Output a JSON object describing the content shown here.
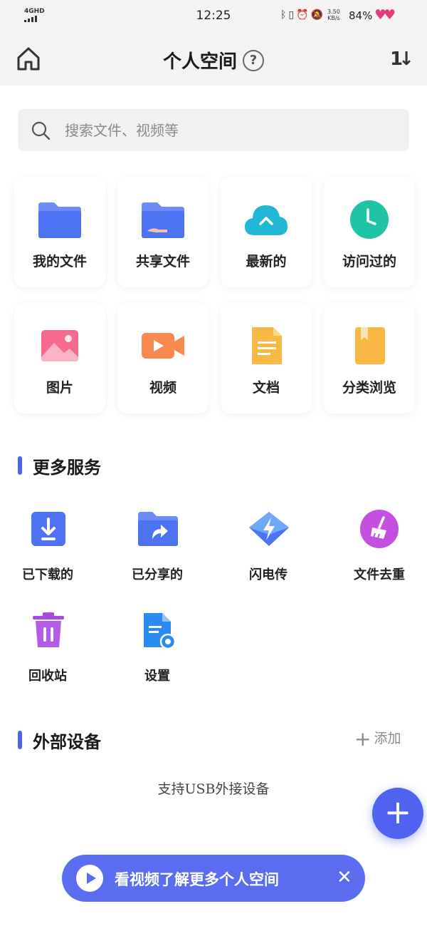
{
  "status_bar": {
    "network": "4GHD",
    "time": "12:25",
    "speed_value": "3.50",
    "speed_unit": "KB/s",
    "battery": "84%"
  },
  "header": {
    "title": "个人空间",
    "help_glyph": "?",
    "sort_glyph": "1↓"
  },
  "search": {
    "placeholder": "搜索文件、视频等"
  },
  "quick_grid": [
    {
      "label": "我的文件",
      "icon": "folder-icon"
    },
    {
      "label": "共享文件",
      "icon": "shared-folder-icon"
    },
    {
      "label": "最新的",
      "icon": "cloud-icon"
    },
    {
      "label": "访问过的",
      "icon": "clock-icon"
    },
    {
      "label": "图片",
      "icon": "image-icon"
    },
    {
      "label": "视频",
      "icon": "video-icon"
    },
    {
      "label": "文档",
      "icon": "document-icon"
    },
    {
      "label": "分类浏览",
      "icon": "bookmark-document-icon"
    }
  ],
  "more_services": {
    "title": "更多服务",
    "items": [
      {
        "label": "已下载的",
        "icon": "download-icon"
      },
      {
        "label": "已分享的",
        "icon": "share-folder-icon"
      },
      {
        "label": "闪电传",
        "icon": "lightning-icon"
      },
      {
        "label": "文件去重",
        "icon": "broom-icon"
      },
      {
        "label": "回收站",
        "icon": "trash-icon"
      },
      {
        "label": "设置",
        "icon": "settings-document-icon"
      }
    ]
  },
  "external_devices": {
    "title": "外部设备",
    "add_label": "添加",
    "hint": "支持USB外接设备"
  },
  "fab": {
    "glyph": "+"
  },
  "banner": {
    "text": "看视频了解更多个人空间",
    "close_glyph": "✕"
  },
  "colors": {
    "accent": "#4f62f0",
    "heart": "#e8387c"
  }
}
